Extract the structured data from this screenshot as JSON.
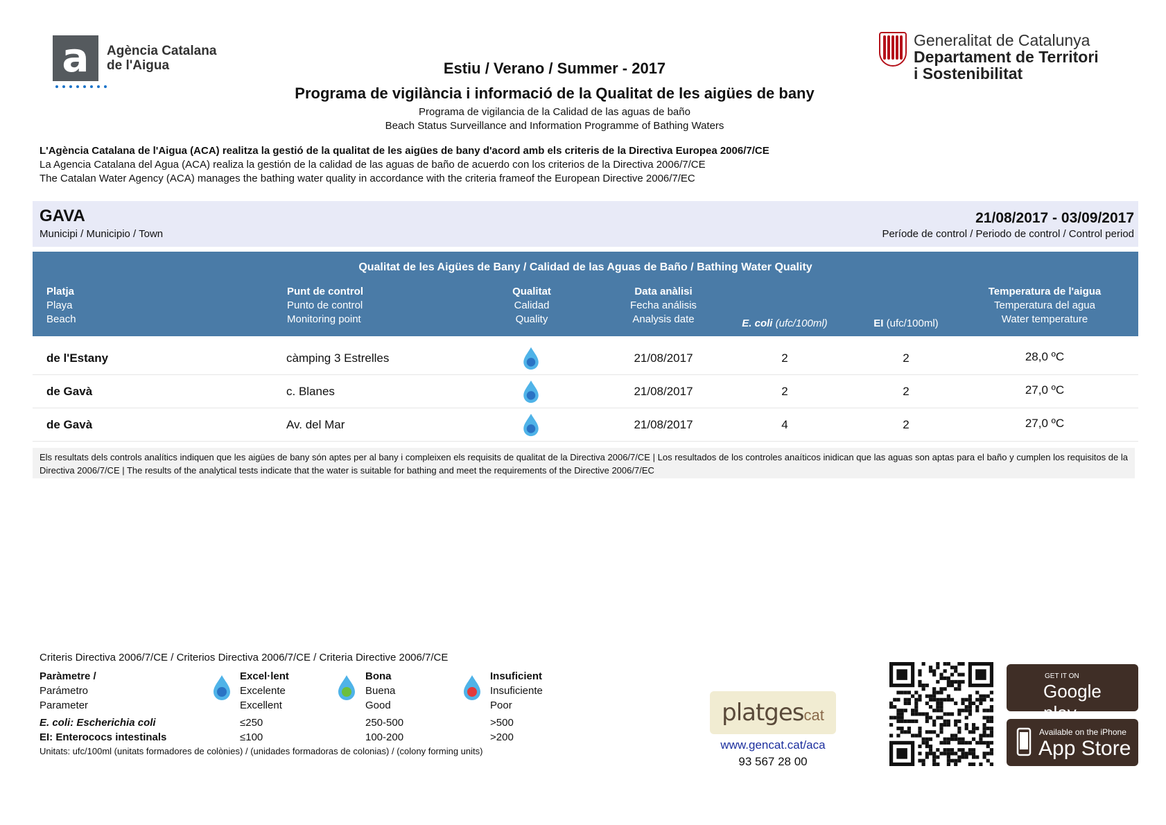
{
  "header": {
    "aca_logo_line1": "Agència Catalana",
    "aca_logo_line2": "de l'Aigua",
    "aca_logo_letter": "a",
    "gen_line1": "Generalitat de Catalunya",
    "gen_line2": "Departament de Territori",
    "gen_line3": "i Sostenibilitat",
    "season": "Estiu / Verano / Summer - 2017",
    "title_ca": "Programa de vigilància i informació de la Qualitat de les aigües de bany",
    "title_es": "Programa de vigilancia de la Calidad de las aguas de baño",
    "title_en": "Beach Status Surveillance and Information Programme of Bathing Waters"
  },
  "intro": {
    "ca": "L'Agència Catalana de l'Aigua (ACA) realitza la gestió de la qualitat de les aigües de bany d'acord amb els criteris de la Directiva Europea 2006/7/CE",
    "es": "La Agencia Catalana del Agua (ACA) realiza la gestión de la calidad de las aguas de baño de acuerdo con los criterios de la Directiva 2006/7/CE",
    "en": "The Catalan Water Agency (ACA) manages the bathing water quality in accordance with the criteria frameof the European Directive 2006/7/EC"
  },
  "town": {
    "name": "GAVA",
    "label": "Municipi / Municipio / Town",
    "period": "21/08/2017 - 03/09/2017",
    "period_label": "Període de control / Periodo de control / Control period"
  },
  "table": {
    "title": "Qualitat de les Aigües de Bany / Calidad de las Aguas de Baño / Bathing Water Quality",
    "col_beach": [
      "Platja",
      "Playa",
      "Beach"
    ],
    "col_point": [
      "Punt de control",
      "Punto de control",
      "Monitoring point"
    ],
    "col_quality": [
      "Qualitat",
      "Calidad",
      "Quality"
    ],
    "col_date": [
      "Data anàlisi",
      "Fecha análisis",
      "Analysis date"
    ],
    "col_ecoli_name": "E. coli",
    "col_ecoli_unit": "(ufc/100ml)",
    "col_ei_name": "EI",
    "col_ei_unit": "(ufc/100ml)",
    "col_temp": [
      "Temperatura de l'aigua",
      "Temperatura del agua",
      "Water temperature"
    ],
    "rows": [
      {
        "beach": "de l'Estany",
        "point": "càmping 3 Estrelles",
        "quality": "excellent",
        "date": "21/08/2017",
        "ecoli": "2",
        "ei": "2",
        "temp": "28,0 ºC"
      },
      {
        "beach": "de Gavà",
        "point": "c. Blanes",
        "quality": "excellent",
        "date": "21/08/2017",
        "ecoli": "2",
        "ei": "2",
        "temp": "27,0 ºC"
      },
      {
        "beach": "de Gavà",
        "point": "Av. del Mar",
        "quality": "excellent",
        "date": "21/08/2017",
        "ecoli": "4",
        "ei": "2",
        "temp": "27,0 ºC"
      }
    ]
  },
  "note": "Els resultats dels controls analítics indiquen que les aigües de bany són aptes per al bany i compleixen els requisits de qualitat de la Directiva  2006/7/CE | Los resultados de los controles anaíticos inidican que las aguas son aptas para el baño y cumplen los requisitos de la Directiva 2006/7/CE | The results of the analytical tests indicate that the water is suitable for bathing and meet the requirements of the Directive 2006/7/EC",
  "criteria": {
    "title": "Criteris Directiva 2006/7/CE / Criterios Directiva 2006/7/CE / Criteria Directive 2006/7/CE",
    "param": [
      "Paràmetre /",
      "Parámetro",
      "Parameter"
    ],
    "excellent": [
      "Excel·lent",
      "Excelente",
      "Excellent"
    ],
    "good": [
      "Bona",
      "Buena",
      "Good"
    ],
    "poor": [
      "Insuficient",
      "Insuficiente",
      "Poor"
    ],
    "ecoli_label_a": "E. coli",
    "ecoli_label_b": ": Escherichia coli",
    "ei_label": "EI: Enterococs intestinals",
    "ecoli_values": [
      "≤250",
      "250-500",
      ">500"
    ],
    "ei_values": [
      "≤100",
      "100-200",
      ">200"
    ],
    "units": "Unitats: ufc/100ml (unitats formadores de colònies) / (unidades formadoras de colonias) / (colony forming units)",
    "colors": {
      "excellent": "#2a73c4",
      "good": "#6cbf3c",
      "poor": "#e23b3b",
      "drop": "#4fb3e8"
    }
  },
  "footer": {
    "platges_a": "platges",
    "platges_b": "cat",
    "url": "www.gencat.cat/aca",
    "phone": "93 567 28 00",
    "gplay_small": "GET IT ON",
    "gplay_big": "Google play",
    "appstore_small": "Available on the iPhone",
    "appstore_big": "App Store"
  }
}
